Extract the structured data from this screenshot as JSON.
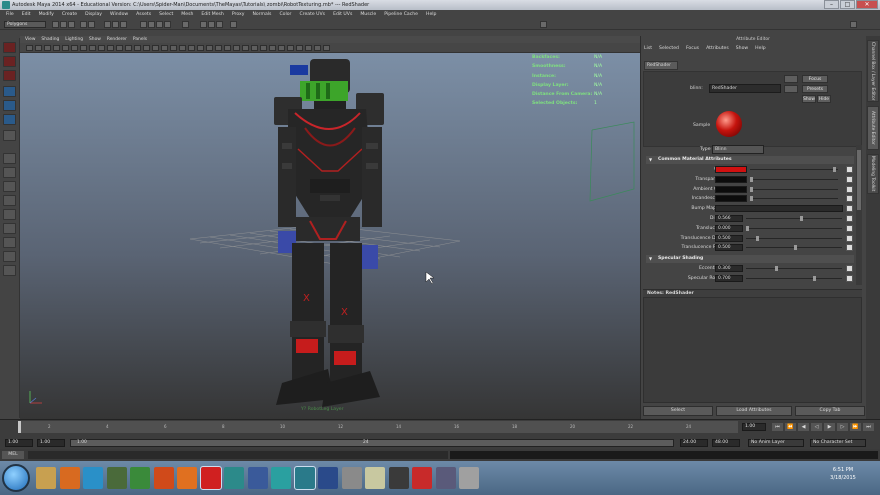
{
  "window": {
    "title": "Autodesk Maya 2014 x64 - Educational Version: C:\\Users\\Spider-Man\\Documents\\TheMayas\\Tutorials\\ zombi\\RobotTexturing.mb* --- RedShader",
    "btn_min": "–",
    "btn_max": "□",
    "btn_close": "✕"
  },
  "menubar": [
    "File",
    "Edit",
    "Modify",
    "Create",
    "Display",
    "Window",
    "Assets",
    "Select",
    "Mesh",
    "Edit Mesh",
    "Proxy",
    "Normals",
    "Color",
    "Create UVs",
    "Edit UVs",
    "Muscle",
    "Pipeline Cache",
    "Help"
  ],
  "status": {
    "mode": "Polygons"
  },
  "viewport": {
    "menu": [
      "View",
      "Shading",
      "Lighting",
      "Show",
      "Renderer",
      "Panels"
    ],
    "hud": [
      {
        "label": "Backfaces:",
        "value": "N/A"
      },
      {
        "label": "Smoothness:",
        "value": "N/A"
      },
      {
        "label": "Instance:",
        "value": "N/A"
      },
      {
        "label": "Display Layer:",
        "value": "N/A"
      },
      {
        "label": "Distance From Camera:",
        "value": "N/A"
      },
      {
        "label": "Selected Objects:",
        "value": "1"
      }
    ],
    "camera": "Y? RobotLeg Layer"
  },
  "attribute_editor": {
    "title": "Attribute Editor",
    "menu": [
      "List",
      "Selected",
      "Focus",
      "Attributes",
      "Show",
      "Help"
    ],
    "tab": "RedShader",
    "node_label": "blinn:",
    "node_name": "RedShader",
    "focus_btn": "Focus",
    "presets_btn": "Presets",
    "show_btn": "Show",
    "hide_btn": "Hide",
    "sample_label": "Sample",
    "type_label": "Type",
    "type_value": "Blinn",
    "section1": "Common Material Attributes",
    "rows1": [
      {
        "label": "Color",
        "kind": "color",
        "color": "#d01010"
      },
      {
        "label": "Transparency",
        "kind": "color",
        "color": "#0c0c0c"
      },
      {
        "label": "Ambient Color",
        "kind": "color",
        "color": "#0c0c0c"
      },
      {
        "label": "Incandescence",
        "kind": "color",
        "color": "#0c0c0c"
      },
      {
        "label": "Bump Mapping",
        "kind": "empty"
      },
      {
        "label": "Diffuse",
        "kind": "num",
        "value": "0.566",
        "pos": 0.566
      },
      {
        "label": "Translucence",
        "kind": "num",
        "value": "0.000",
        "pos": 0
      },
      {
        "label": "Translucence Depth",
        "kind": "num",
        "value": "0.500",
        "pos": 0.1
      },
      {
        "label": "Translucence Focus",
        "kind": "num",
        "value": "0.500",
        "pos": 0.5
      }
    ],
    "section2": "Specular Shading",
    "rows2": [
      {
        "label": "Eccentricity",
        "kind": "num",
        "value": "0.300",
        "pos": 0.3
      },
      {
        "label": "Specular Roll Off",
        "kind": "num",
        "value": "0.700",
        "pos": 0.7
      }
    ],
    "notes_label": "Notes: RedShader",
    "buttons": [
      "Select",
      "Load Attributes",
      "Copy Tab"
    ]
  },
  "side_tabs": [
    "Channel Box / Layer Editor",
    "Attribute Editor",
    "Modeling Toolkit"
  ],
  "timeline": {
    "start": "1.00",
    "range_start": "1.00",
    "range_inner_start": "1.00",
    "range_inner_end": "24",
    "range_end": "24.00",
    "end": "48.00",
    "current": "1.00",
    "anim_layer": "No Anim Layer",
    "char_set": "No Character Set",
    "ticks": [
      "2",
      "4",
      "6",
      "8",
      "10",
      "12",
      "14",
      "16",
      "18",
      "20",
      "22",
      "24"
    ]
  },
  "cmdline": {
    "mel": "MEL"
  },
  "taskbar": {
    "time": "6:51 PM",
    "date": "3/18/2015"
  },
  "colors": {
    "accent": "#d01010",
    "hud_green": "#7fe07f"
  }
}
